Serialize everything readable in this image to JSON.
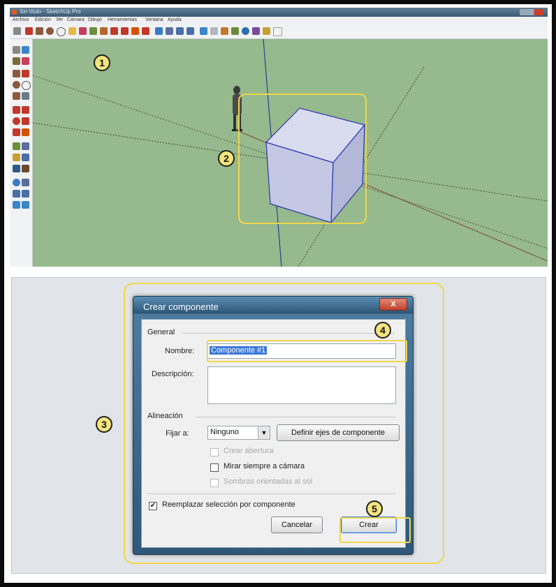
{
  "top_window": {
    "title": "Sin título - SketchUp Pro",
    "menu": [
      "Archivo",
      "Edición",
      "Ver",
      "Cámara",
      "Dibujo",
      "Herramientas",
      "Ventana",
      "Ayuda"
    ]
  },
  "callouts": [
    "1",
    "2",
    "3",
    "4",
    "5"
  ],
  "dialog": {
    "title": "Crear componente",
    "close_label": "X",
    "general_label": "General",
    "name_label": "Nombre:",
    "name_value": "Componente #1",
    "description_label": "Descripción:",
    "description_value": "",
    "alignment_label": "Alineación",
    "fix_label": "Fijar a:",
    "fix_value": "Ninguno",
    "define_axes_label": "Definir ejes de componente",
    "cut_opening_label": "Crear abertura",
    "face_camera_label": "Mirar siempre a cámara",
    "shadows_label": "Sombras orientadas al sol",
    "replace_label": "Reemplazar selección por componente",
    "replace_checked": "✔",
    "cancel_label": "Cancelar",
    "create_label": "Crear"
  }
}
